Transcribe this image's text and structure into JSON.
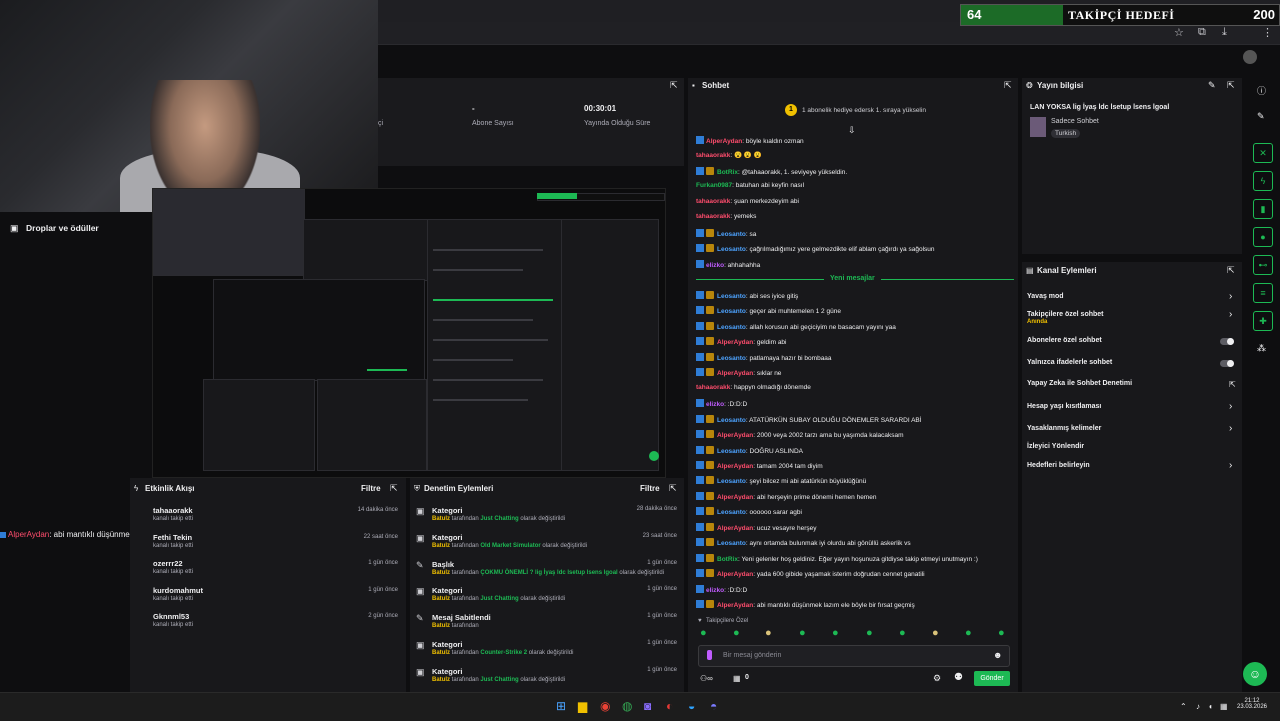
{
  "goal": {
    "current": "64",
    "label": "TAKİPÇİ HEDEFİ",
    "target": "200",
    "progress": 0.32
  },
  "stats": {
    "subs_value": "-",
    "subs_label": "Abone Sayısı",
    "uptime_value": "00:30:01",
    "uptime_label": "Yayında Olduğu Süre",
    "viewers_label": "çi"
  },
  "drops": {
    "label": "Droplar ve ödüller"
  },
  "overlay_chat": {
    "user": "AlperAydan",
    "text": ": abi mantıklı düşünmek lazım ele böyle bir fırsat geçmiş"
  },
  "activity": {
    "title": "Etkinlik Akışı",
    "filter": "Filtre",
    "items": [
      {
        "name": "tahaaorakk",
        "sub": "kanalı takip etti",
        "time": "14 dakika önce"
      },
      {
        "name": "Fethi Tekin",
        "sub": "kanalı takip etti",
        "time": "22 saat önce"
      },
      {
        "name": "ozerrr22",
        "sub": "kanalı takip etti",
        "time": "1 gün önce"
      },
      {
        "name": "kurdomahmut",
        "sub": "kanalı takip etti",
        "time": "1 gün önce"
      },
      {
        "name": "Gknnml53",
        "sub": "kanalı takip etti",
        "time": "2 gün önce"
      }
    ]
  },
  "moderation": {
    "title": "Denetim Eylemleri",
    "filter": "Filtre",
    "items": [
      {
        "title": "Kategori",
        "user": "Batulz",
        "mid": " tarafından ",
        "value": "Just Chatting",
        "end": " olarak değiştirildi",
        "time": "28 dakika önce"
      },
      {
        "title": "Kategori",
        "user": "Batulz",
        "mid": " tarafından ",
        "value": "Old Market Simulator",
        "end": " olarak değiştirildi",
        "time": "23 saat önce"
      },
      {
        "title": "Başlık",
        "user": "Batulz",
        "mid": " tarafından ",
        "value": "ÇOKMU ÖNEMLİ ? lig İyaş ldc lsetup lsens lgoal",
        "end": " olarak değiştirildi",
        "time": "1 gün önce"
      },
      {
        "title": "Kategori",
        "user": "Batulz",
        "mid": " tarafından ",
        "value": "Just Chatting",
        "end": " olarak değiştirildi",
        "time": "1 gün önce"
      },
      {
        "title": "Mesaj Sabitlendi",
        "user": "Batulz",
        "mid": " tarafından",
        "value": "",
        "end": "",
        "time": "1 gün önce"
      },
      {
        "title": "Kategori",
        "user": "Batulz",
        "mid": " tarafından ",
        "value": "Counter-Strike 2",
        "end": " olarak değiştirildi",
        "time": "1 gün önce"
      },
      {
        "title": "Kategori",
        "user": "Batulz",
        "mid": " tarafından ",
        "value": "Just Chatting",
        "end": " olarak değiştirildi",
        "time": "1 gün önce"
      }
    ]
  },
  "chat": {
    "title": "Sohbet",
    "pinned": "1 abonelik hediye edersk 1. sıraya yükselin",
    "new_messages": "Yeni mesajlar",
    "followers_only": "Takipçilere Özel",
    "input_placeholder": "Bir mesaj gönderin",
    "send": "Gönder",
    "points": "0",
    "messages": [
      {
        "user": "AlperAydan",
        "color": "#ff4d6d",
        "text": ": böyle kıaldın ozman",
        "badges": 1
      },
      {
        "user": "tahaaorakk",
        "color": "#ff4d6d",
        "text": ": 😮 😮 😮",
        "badges": 0
      },
      {
        "user": "BotRix",
        "color": "#1db954",
        "text": ": @tahaaorakk, 1. seviyeye yükseldin.",
        "badges": 2
      },
      {
        "user": "Furkan0987",
        "color": "#1db954",
        "text": ": batuhan abi keyfin nasıl",
        "badges": 0
      },
      {
        "user": "tahaaorakk",
        "color": "#ff4d6d",
        "text": ": şuan merkezdeyim abi",
        "badges": 0
      },
      {
        "user": "tahaaorakk",
        "color": "#ff4d6d",
        "text": ": yemeks",
        "badges": 0
      },
      {
        "user": "Leosanto",
        "color": "#4da3ff",
        "text": ": sa",
        "badges": 2
      },
      {
        "user": "Leosanto",
        "color": "#4da3ff",
        "text": ": çağrılmadığımız yere gelmezdikte elif ablam çağırdı ya sağolsun",
        "badges": 2
      },
      {
        "user": "elizko",
        "color": "#c05cff",
        "text": ": ahhahahha",
        "badges": 1
      },
      {
        "user": "Leosanto",
        "color": "#4da3ff",
        "text": ": abi ses iyice gitiş",
        "badges": 2
      },
      {
        "user": "Leosanto",
        "color": "#4da3ff",
        "text": ": geçer abi muhtemelen 1 2 güne",
        "badges": 2
      },
      {
        "user": "Leosanto",
        "color": "#4da3ff",
        "text": ": allah korusun abi geçiciyim ne basacam yayını yaa",
        "badges": 2
      },
      {
        "user": "AlperAydan",
        "color": "#ff4d6d",
        "text": ": geldim abi",
        "badges": 2
      },
      {
        "user": "Leosanto",
        "color": "#4da3ff",
        "text": ": patlamaya hazır bi bombaaa",
        "badges": 2
      },
      {
        "user": "AlperAydan",
        "color": "#ff4d6d",
        "text": ": sıklar ne",
        "badges": 2
      },
      {
        "user": "tahaaorakk",
        "color": "#ff4d6d",
        "text": ": happyn olmadığı dönemde",
        "badges": 0
      },
      {
        "user": "elizko",
        "color": "#c05cff",
        "text": ": :D:D:D",
        "badges": 1
      },
      {
        "user": "Leosanto",
        "color": "#4da3ff",
        "text": ": ATATÜRKÜN SUBAY OLDUĞU DÖNEMLER SARARDI ABİ",
        "badges": 2
      },
      {
        "user": "AlperAydan",
        "color": "#ff4d6d",
        "text": ": 2000 veya 2002 tarzı ama bu yaşımda kalacaksam",
        "badges": 2
      },
      {
        "user": "Leosanto",
        "color": "#4da3ff",
        "text": ": DOĞRU ASLINDA",
        "badges": 2
      },
      {
        "user": "AlperAydan",
        "color": "#ff4d6d",
        "text": ": tamam 2004 tam diyim",
        "badges": 2
      },
      {
        "user": "Leosanto",
        "color": "#4da3ff",
        "text": ": şeyi bilcez mi abi atatürkün büyüklüğünü",
        "badges": 2
      },
      {
        "user": "AlperAydan",
        "color": "#ff4d6d",
        "text": ": abi herşeyin prime dönemi hemen hemen",
        "badges": 2
      },
      {
        "user": "Leosanto",
        "color": "#4da3ff",
        "text": ": oooooo sarar agbi",
        "badges": 2
      },
      {
        "user": "AlperAydan",
        "color": "#ff4d6d",
        "text": ": ucuz vesayre herşey",
        "badges": 2
      },
      {
        "user": "Leosanto",
        "color": "#4da3ff",
        "text": ": aynı ortamda bulunmak iyi olurdu abi gönüllü askerlik vs",
        "badges": 2
      },
      {
        "user": "BotRix",
        "color": "#1db954",
        "text": ": Yeni gelenler hoş geldiniz. Eğer yayın hoşunuza gitdiyse takip etmeyi unutmayın :)",
        "badges": 2
      },
      {
        "user": "AlperAydan",
        "color": "#ff4d6d",
        "text": ": yada 600 gibide yaşamak isterim doğrudan cennet ganatili",
        "badges": 2
      },
      {
        "user": "elizko",
        "color": "#c05cff",
        "text": ": :D:D:D",
        "badges": 1
      },
      {
        "user": "AlperAydan",
        "color": "#ff4d6d",
        "text": ": abi mantıklı düşünmek lazım ele böyle bir fırsat geçmiş",
        "badges": 2
      }
    ]
  },
  "stream_info": {
    "title": "Yayın bilgisi",
    "stream_title": "LAN YOKSA lig İyaş ldc lsetup lsens lgoal",
    "mode": "Sadece Sohbet",
    "language": "Turkish"
  },
  "channel": {
    "title": "Kanal Eylemleri",
    "items": [
      {
        "label": "Yavaş mod",
        "sub": "",
        "control": "chevron"
      },
      {
        "label": "Takipçilere özel sohbet",
        "sub": "Anında",
        "control": "chevron"
      },
      {
        "label": "Abonelere özel sohbet",
        "sub": "",
        "control": "toggle"
      },
      {
        "label": "Yalnızca ifadelerle sohbet",
        "sub": "",
        "control": "toggle"
      },
      {
        "label": "Yapay Zeka ile Sohbet Denetimi",
        "sub": "",
        "control": "external"
      },
      {
        "label": "Hesap yaşı kısıtlaması",
        "sub": "",
        "control": "chevron"
      },
      {
        "label": "Yasaklanmış kelimeler",
        "sub": "",
        "control": "chevron"
      },
      {
        "label": "İzleyici Yönlendir",
        "sub": "",
        "control": "none"
      },
      {
        "label": "Hedefleri belirleyin",
        "sub": "",
        "control": "chevron"
      }
    ]
  },
  "taskbar": {
    "time": "21:12",
    "date": "23.03.2026"
  }
}
